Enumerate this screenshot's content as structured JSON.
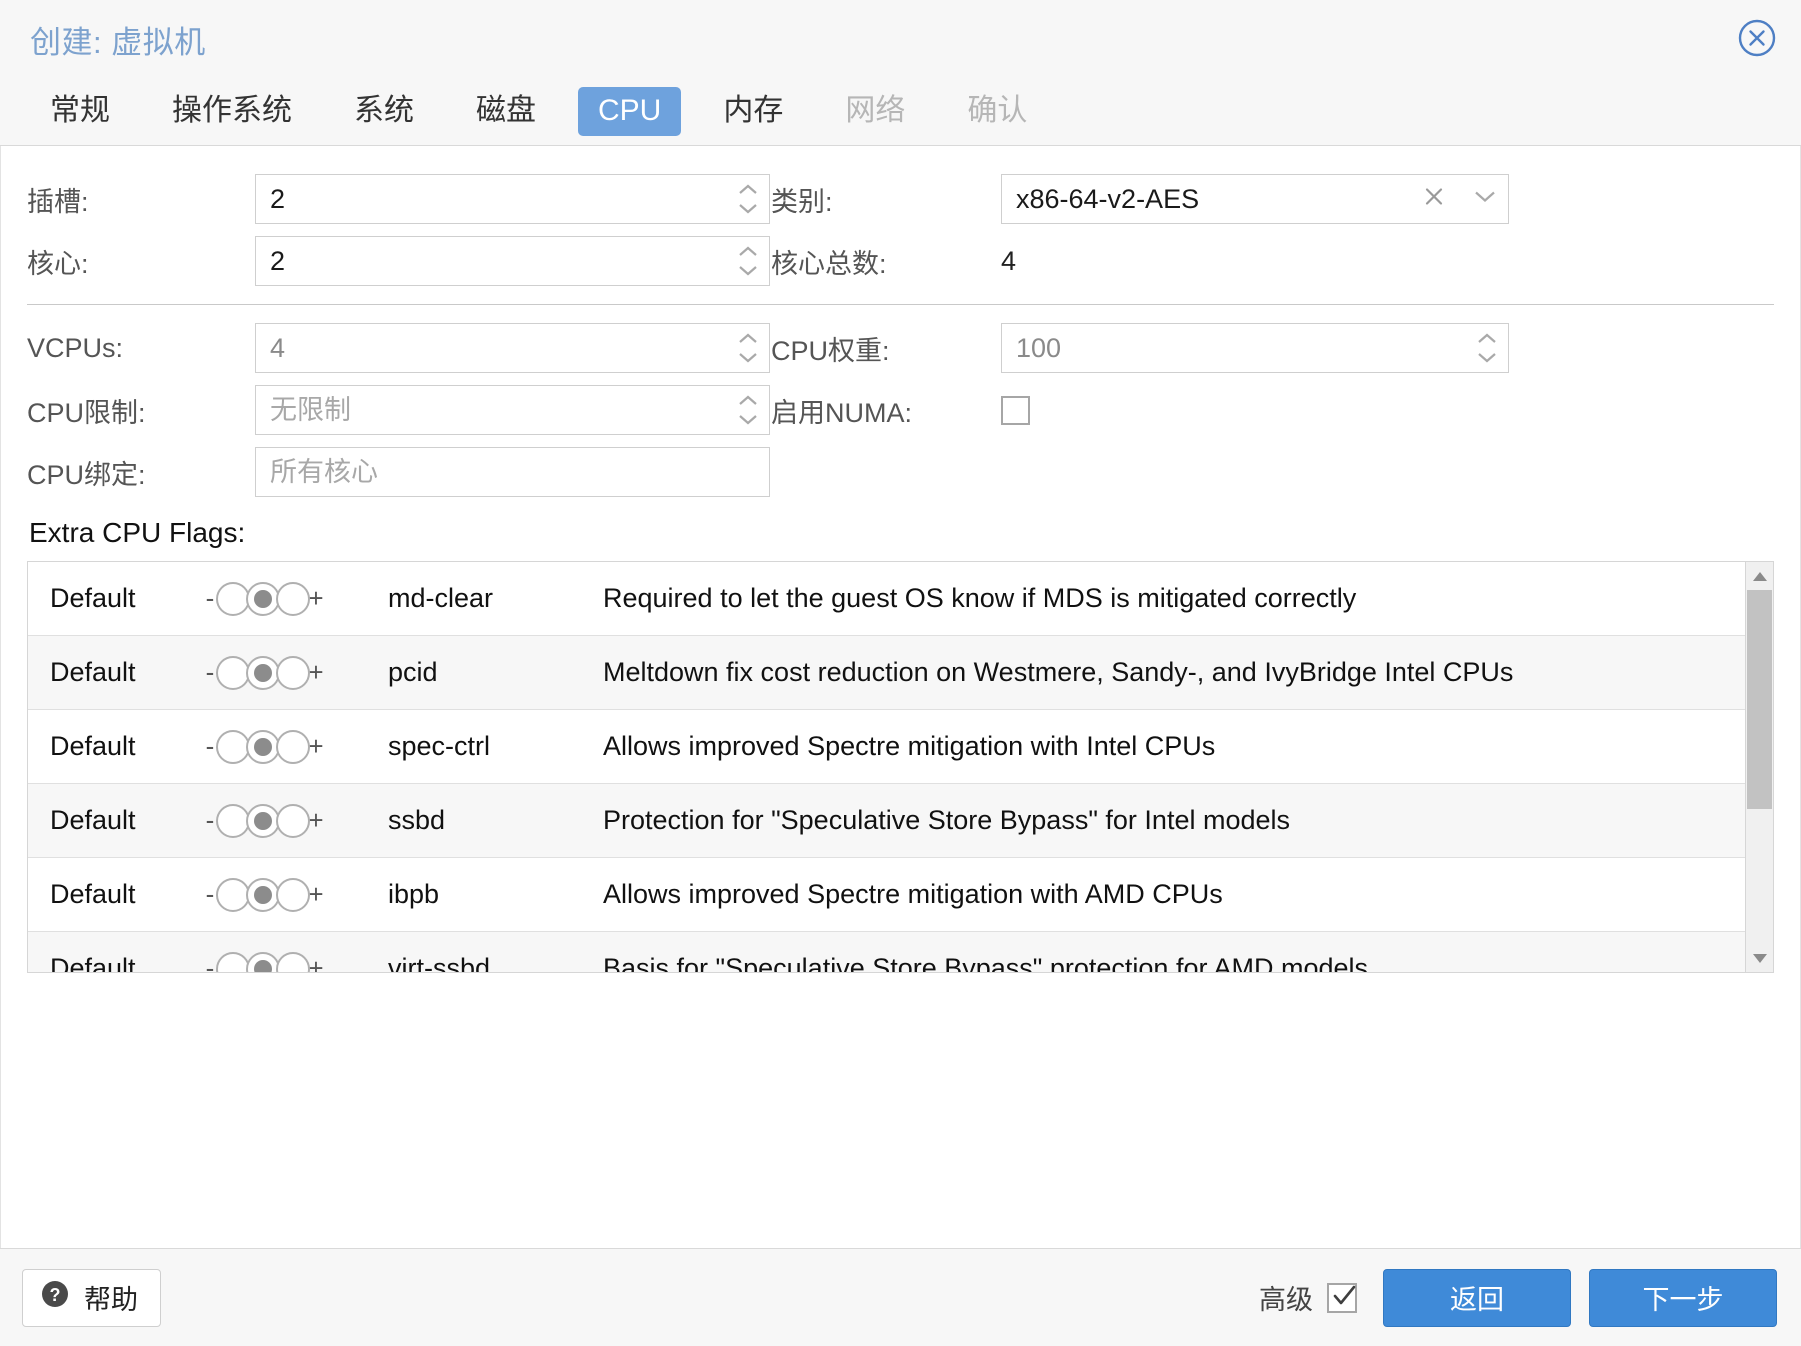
{
  "window": {
    "title": "创建: 虚拟机",
    "close_icon": "close-circle-icon"
  },
  "tabs": [
    {
      "label": "常规",
      "state": "normal"
    },
    {
      "label": "操作系统",
      "state": "normal"
    },
    {
      "label": "系统",
      "state": "normal"
    },
    {
      "label": "磁盘",
      "state": "normal"
    },
    {
      "label": "CPU",
      "state": "active"
    },
    {
      "label": "内存",
      "state": "normal"
    },
    {
      "label": "网络",
      "state": "disabled"
    },
    {
      "label": "确认",
      "state": "disabled"
    }
  ],
  "form": {
    "sockets": {
      "label": "插槽:",
      "value": "2"
    },
    "cores": {
      "label": "核心:",
      "value": "2"
    },
    "type": {
      "label": "类别:",
      "value": "x86-64-v2-AES",
      "clear_icon": "clear-x-icon",
      "expand_icon": "chevron-down-icon"
    },
    "total_cores": {
      "label": "核心总数:",
      "value": "4"
    },
    "vcpus": {
      "label": "VCPUs:",
      "value": "4"
    },
    "cpu_limit": {
      "label": "CPU限制:",
      "value": "",
      "placeholder": "无限制"
    },
    "cpu_affinity": {
      "label": "CPU绑定:",
      "value": "",
      "placeholder": "所有核心"
    },
    "cpu_units": {
      "label": "CPU权重:",
      "value": "100"
    },
    "enable_numa": {
      "label": "启用NUMA:",
      "checked": false
    }
  },
  "flags": {
    "title": "Extra CPU Flags:",
    "state_label": "Default",
    "minus": "-",
    "plus": "+",
    "rows": [
      {
        "state": "Default",
        "name": "md-clear",
        "desc": "Required to let the guest OS know if MDS is mitigated correctly",
        "selected": 1
      },
      {
        "state": "Default",
        "name": "pcid",
        "desc": "Meltdown fix cost reduction on Westmere, Sandy-, and IvyBridge Intel CPUs",
        "selected": 1
      },
      {
        "state": "Default",
        "name": "spec-ctrl",
        "desc": "Allows improved Spectre mitigation with Intel CPUs",
        "selected": 1
      },
      {
        "state": "Default",
        "name": "ssbd",
        "desc": "Protection for \"Speculative Store Bypass\" for Intel models",
        "selected": 1
      },
      {
        "state": "Default",
        "name": "ibpb",
        "desc": "Allows improved Spectre mitigation with AMD CPUs",
        "selected": 1
      },
      {
        "state": "Default",
        "name": "virt-ssbd",
        "desc": "Basis for \"Speculative Store Bypass\" protection for AMD models",
        "selected": 1
      }
    ],
    "scroll_up_icon": "scroll-up-arrow-icon",
    "scroll_down_icon": "scroll-down-arrow-icon"
  },
  "footer": {
    "help_label": "帮助",
    "help_icon": "question-mark-icon",
    "advanced_label": "高级",
    "advanced_checked": true,
    "back_label": "返回",
    "next_label": "下一步"
  },
  "colors": {
    "accent": "#3f8ad8",
    "tab_active_bg": "#6ea2dd",
    "title": "#7da2ce",
    "chrome_bg": "#f7f7f7"
  }
}
